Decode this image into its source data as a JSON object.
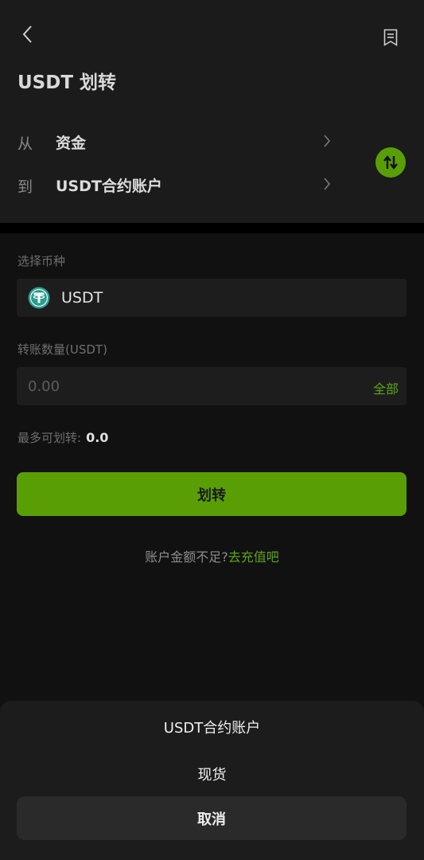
{
  "header": {
    "title": "USDT 划转",
    "back_icon": "chevron-left-icon",
    "record_icon": "bookmark-list-icon"
  },
  "transfer": {
    "from_label": "从",
    "from_value": "资金",
    "to_label": "到",
    "to_value": "USDT合约账户",
    "swap_icon": "swap-arrows-icon"
  },
  "form": {
    "coin_label": "选择币种",
    "coin_name": "USDT",
    "coin_icon": "tether-icon",
    "amount_label": "转账数量(USDT)",
    "amount_placeholder": "0.00",
    "all_label": "全部",
    "max_label": "最多可划转:",
    "max_value": "0.0"
  },
  "actions": {
    "transfer_label": "划转",
    "tip_text": "账户金额不足?",
    "tip_link": "去充值吧"
  },
  "sheet": {
    "options": [
      "USDT合约账户",
      "现货"
    ],
    "cancel_label": "取消"
  },
  "colors": {
    "accent": "#5a9e06",
    "link": "#5fa31a",
    "background": "#111111",
    "panel": "#1b1b1b"
  }
}
